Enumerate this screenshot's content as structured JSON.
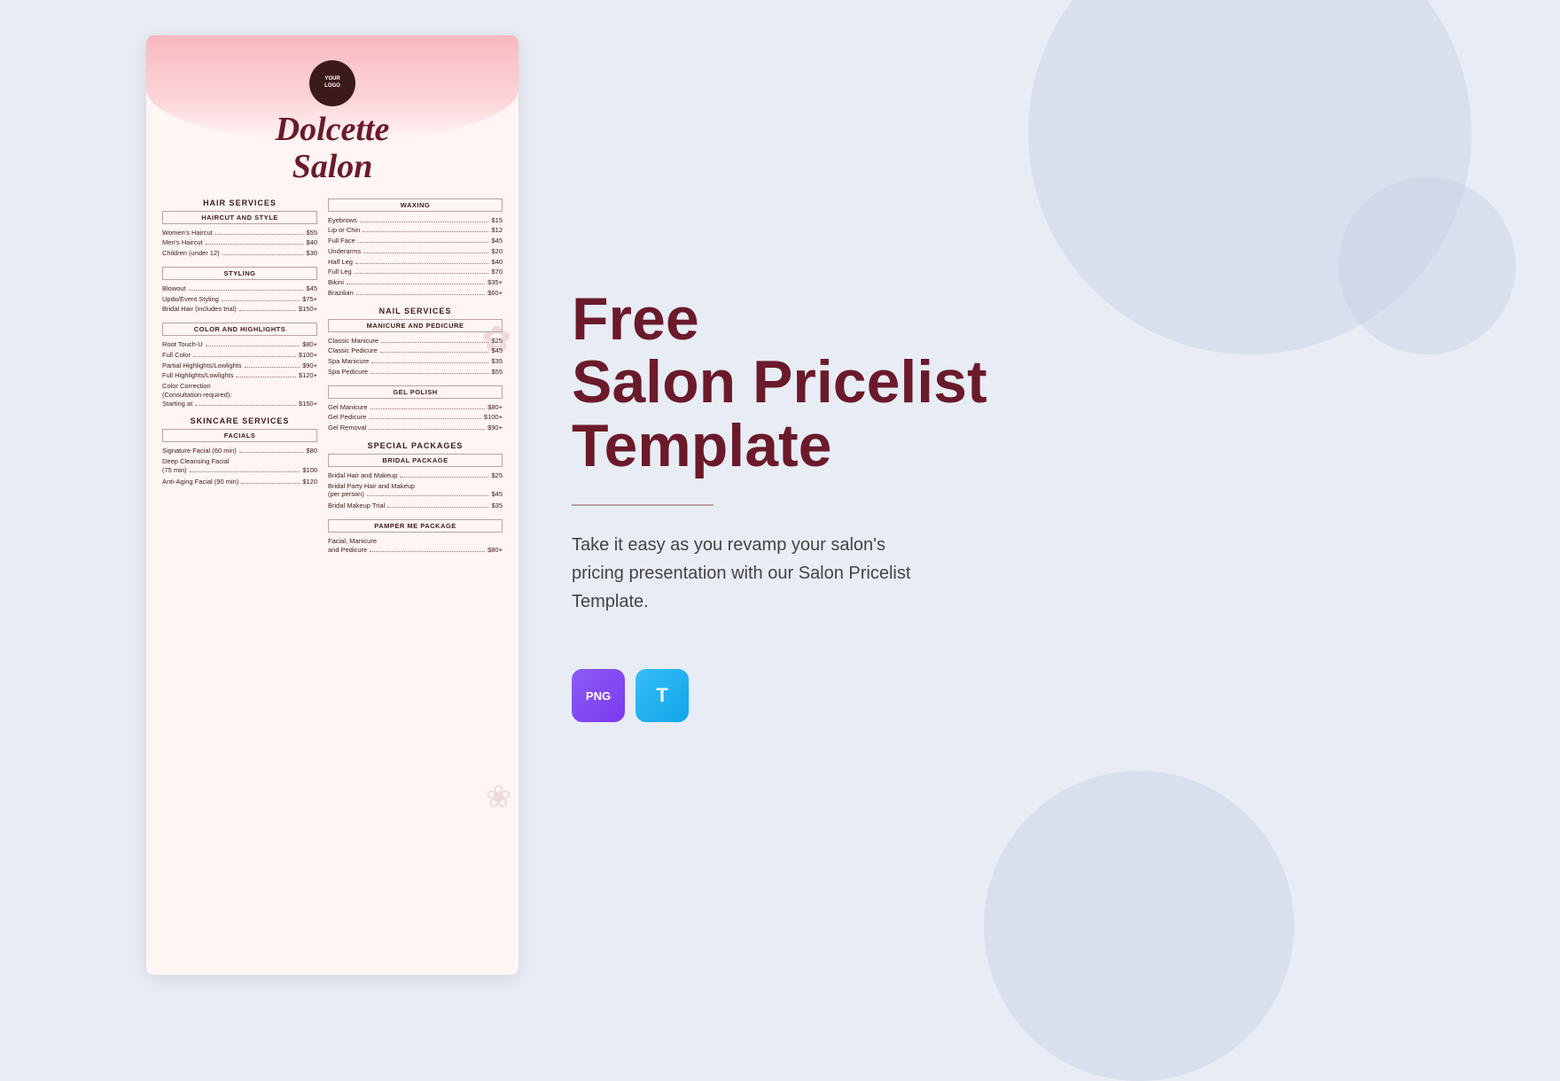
{
  "background": {
    "color": "#e8ecf5"
  },
  "menu": {
    "logo_text": "YOUR\nLOGO",
    "salon_name_line1": "Dolcette",
    "salon_name_line2": "Salon",
    "left_column": {
      "hair_services": {
        "title": "HAIR SERVICES",
        "haircut_and_style": {
          "label": "HAIRCUT AND STYLE",
          "items": [
            {
              "name": "Women's Haircut",
              "price": "$55"
            },
            {
              "name": "Men's Haircut",
              "price": "$40"
            },
            {
              "name": "Children (under 12)",
              "price": "$30"
            }
          ]
        },
        "styling": {
          "label": "STYLING",
          "items": [
            {
              "name": "Blowout",
              "price": "$45"
            },
            {
              "name": "Updo/Event Styling",
              "price": "$75+"
            },
            {
              "name": "Bridal Hair (includes trial)",
              "price": "$150+"
            }
          ]
        },
        "color_and_highlights": {
          "label": "COLOR AND HIGHLIGHTS",
          "items": [
            {
              "name": "Root Touch-U",
              "price": "$80+"
            },
            {
              "name": "Full Color",
              "price": "$100+"
            },
            {
              "name": "Partial Highlights/Lowlights",
              "price": "$90+"
            },
            {
              "name": "Full Highlights/Lowlights",
              "price": "$120+"
            },
            {
              "name": "Color Correction\n(Consultation required):\nStarting at",
              "price": "$150+"
            }
          ]
        }
      },
      "skincare_services": {
        "title": "SKINCARE SERVICES",
        "facials": {
          "label": "FACIALS",
          "items": [
            {
              "name": "Signature Facial (60 min)",
              "price": "$80"
            },
            {
              "name": "Deep Cleansing Facial\n(75 min)",
              "price": "$100"
            },
            {
              "name": "Anti-Aging Facial (90 min)",
              "price": "$120"
            }
          ]
        }
      }
    },
    "right_column": {
      "waxing": {
        "label": "WAXING",
        "items": [
          {
            "name": "Eyebrows",
            "price": "$15"
          },
          {
            "name": "Lip or Chin",
            "price": "$12"
          },
          {
            "name": "Full Face",
            "price": "$45"
          },
          {
            "name": "Underarms",
            "price": "$20"
          },
          {
            "name": "Half Leg",
            "price": "$40"
          },
          {
            "name": "Full Leg",
            "price": "$70"
          },
          {
            "name": "Bikini",
            "price": "$35+"
          },
          {
            "name": "Brazilian",
            "price": "$60+"
          }
        ]
      },
      "nail_services": {
        "title": "NAIL SERVICES",
        "manicure_pedicure": {
          "label": "MANICURE AND PEDICURE",
          "items": [
            {
              "name": "Classic Manicure",
              "price": "$25"
            },
            {
              "name": "Classic Pedicure",
              "price": "$45"
            },
            {
              "name": "Spa Manicure",
              "price": "$35"
            },
            {
              "name": "Spa Pedicure",
              "price": "$55"
            }
          ]
        },
        "gel_polish": {
          "label": "GEL POLISH",
          "items": [
            {
              "name": "Gel Manicure",
              "price": "$80+"
            },
            {
              "name": "Gel Pedicure",
              "price": "$100+"
            },
            {
              "name": "Gel Removal",
              "price": "$90+"
            }
          ]
        }
      },
      "special_packages": {
        "title": "SPECIAL PACKAGES",
        "bridal_package": {
          "label": "BRIDAL PACKAGE",
          "items": [
            {
              "name": "Bridal Hair and Makeup",
              "price": "$25"
            },
            {
              "name": "Bridal Party Hair and Makeup\n(per person)",
              "price": "$45"
            },
            {
              "name": "Bridal Makeup Trial",
              "price": "$35"
            }
          ]
        },
        "pamper_me_package": {
          "label": "PAMPER ME PACKAGE",
          "items": [
            {
              "name": "Facial, Manicure\nand Pedicure",
              "price": "$80+"
            }
          ]
        }
      }
    }
  },
  "promo": {
    "title_line1": "Free",
    "title_line2": "Salon Pricelist",
    "title_line3": "Template",
    "description": "Take it easy as you revamp your salon's\npricing presentation with our Salon Pricelist\nTemplate.",
    "formats": [
      {
        "label": "PNG",
        "type": "png"
      },
      {
        "label": "T",
        "type": "template"
      }
    ]
  }
}
